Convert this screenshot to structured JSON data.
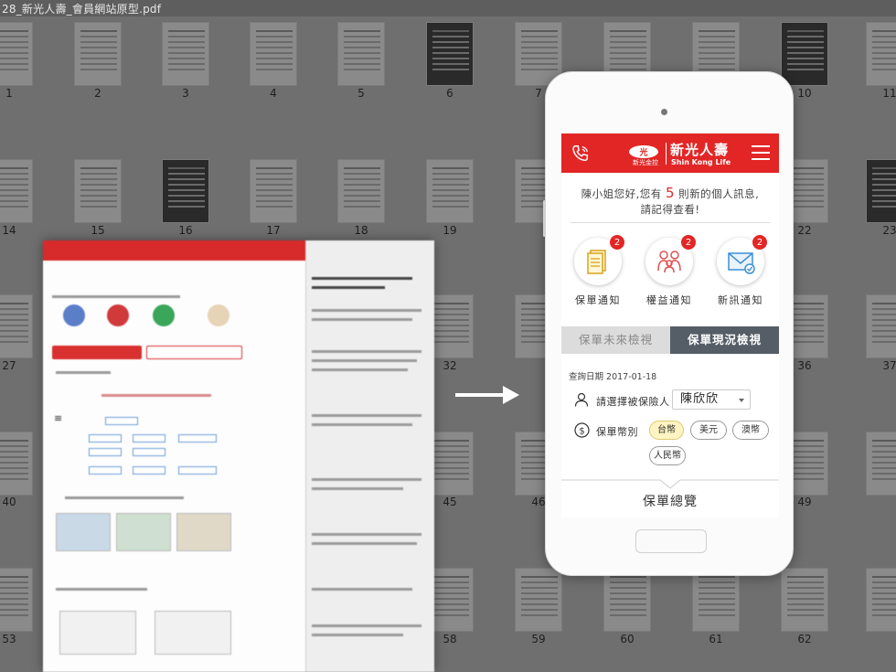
{
  "window": {
    "title": "28_新光人壽_會員網站原型.pdf"
  },
  "thumbnails": {
    "page_numbers": [
      "1",
      "2",
      "3",
      "4",
      "5",
      "6",
      "7",
      "10",
      "11",
      "14",
      "15",
      "16",
      "17",
      "18",
      "19",
      "22",
      "23",
      "27",
      "32",
      "36",
      "37",
      "40",
      "45",
      "46",
      "49",
      "53",
      "58",
      "59",
      "60",
      "61",
      "62"
    ]
  },
  "app": {
    "brand": {
      "name_zh": "新光人壽",
      "name_en": "Shin Kong Life",
      "group": "新光金控"
    },
    "greeting": {
      "prefix": "陳小姐您好,您有",
      "count": "5",
      "suffix": "則新的個人訊息,",
      "line2": "請記得查看!"
    },
    "notifications": [
      {
        "label": "保單通知",
        "badge": "2",
        "icon": "policy-document-icon"
      },
      {
        "label": "權益通知",
        "badge": "2",
        "icon": "family-icon"
      },
      {
        "label": "新訊通知",
        "badge": "2",
        "icon": "mail-icon"
      }
    ],
    "tabs": {
      "future": "保單未來檢視",
      "current": "保單現況檢視"
    },
    "query_date": "查詢日期 2017-01-18",
    "insured": {
      "label": "請選擇被保險人",
      "value": "陳欣欣"
    },
    "currency": {
      "label": "保單幣別",
      "options": [
        "台幣",
        "美元",
        "澳幣",
        "人民幣"
      ],
      "selected": "台幣"
    },
    "overview": "保單總覽"
  },
  "colors": {
    "brand_red": "#e22626",
    "tab_active": "#555d66",
    "badge": "#e22626",
    "pill_selected": "#fff4c2"
  }
}
